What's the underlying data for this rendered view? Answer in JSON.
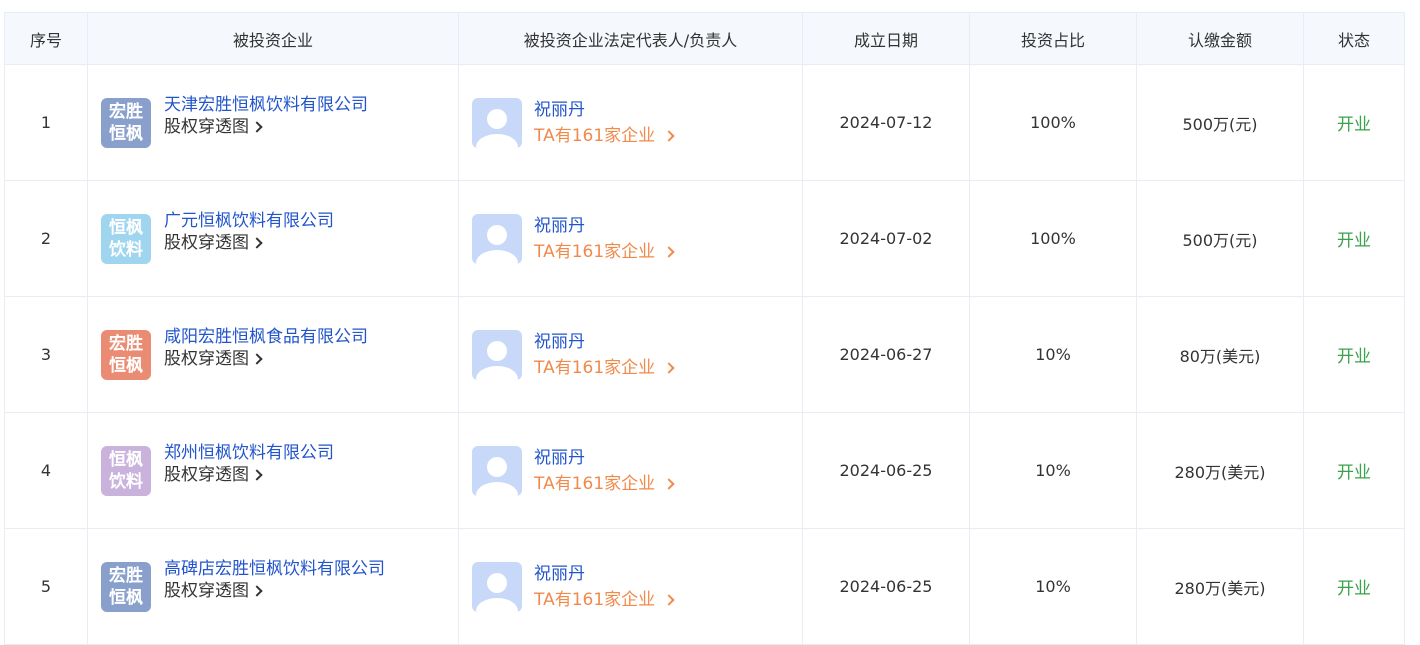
{
  "headers": {
    "idx": "序号",
    "company": "被投资企业",
    "rep": "被投资企业法定代表人/负责人",
    "date": "成立日期",
    "ratio": "投资占比",
    "amount": "认缴金额",
    "status": "状态"
  },
  "rows": [
    {
      "idx": "1",
      "logo_lines": [
        "宏胜",
        "恒枫"
      ],
      "logo_color": "#8aa0cc",
      "company": "天津宏胜恒枫饮料有限公司",
      "equity_link": "股权穿透图",
      "rep_name": "祝丽丹",
      "rep_link": "TA有161家企业",
      "date": "2024-07-12",
      "ratio": "100%",
      "amount": "500万(元)",
      "status": "开业"
    },
    {
      "idx": "2",
      "logo_lines": [
        "恒枫",
        "饮料"
      ],
      "logo_color": "#9fd5ee",
      "company": "广元恒枫饮料有限公司",
      "equity_link": "股权穿透图",
      "rep_name": "祝丽丹",
      "rep_link": "TA有161家企业",
      "date": "2024-07-02",
      "ratio": "100%",
      "amount": "500万(元)",
      "status": "开业"
    },
    {
      "idx": "3",
      "logo_lines": [
        "宏胜",
        "恒枫"
      ],
      "logo_color": "#e98c73",
      "company": "咸阳宏胜恒枫食品有限公司",
      "equity_link": "股权穿透图",
      "rep_name": "祝丽丹",
      "rep_link": "TA有161家企业",
      "date": "2024-06-27",
      "ratio": "10%",
      "amount": "80万(美元)",
      "status": "开业"
    },
    {
      "idx": "4",
      "logo_lines": [
        "恒枫",
        "饮料"
      ],
      "logo_color": "#c9b3dc",
      "company": "郑州恒枫饮料有限公司",
      "equity_link": "股权穿透图",
      "rep_name": "祝丽丹",
      "rep_link": "TA有161家企业",
      "date": "2024-06-25",
      "ratio": "10%",
      "amount": "280万(美元)",
      "status": "开业"
    },
    {
      "idx": "5",
      "logo_lines": [
        "宏胜",
        "恒枫"
      ],
      "logo_color": "#8aa0cc",
      "company": "高碑店宏胜恒枫饮料有限公司",
      "equity_link": "股权穿透图",
      "rep_name": "祝丽丹",
      "rep_link": "TA有161家企业",
      "date": "2024-06-25",
      "ratio": "10%",
      "amount": "280万(美元)",
      "status": "开业"
    }
  ],
  "colors": {
    "link_blue": "#2255cc",
    "orange": "#f08a4b",
    "status_green": "#3aa34a",
    "header_bg": "#f5f8fd",
    "avatar_bg": "#c7d8f8"
  }
}
